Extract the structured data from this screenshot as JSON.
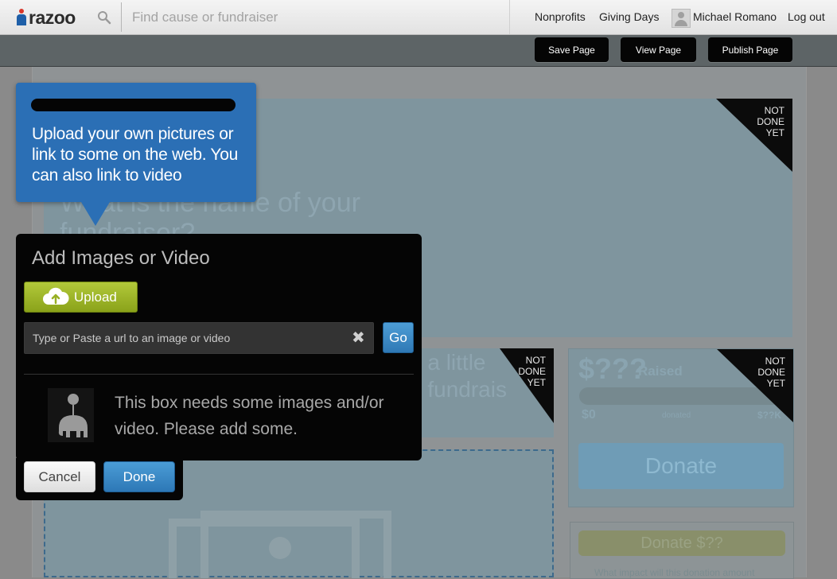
{
  "nav": {
    "logo_text": "razoo",
    "search_placeholder": "Find cause or fundraiser",
    "links": [
      "Nonprofits",
      "Giving Days"
    ],
    "user_name": "Michael Romano",
    "logout": "Log out"
  },
  "toolbar": {
    "save": "Save Page",
    "view": "View Page",
    "publish": "Publish Page"
  },
  "page": {
    "hero_faint_line1": "What is the name of your",
    "hero_faint_line2": "fundraiser?",
    "mid_faint_line1": "g a little",
    "mid_faint_line2": "o fundrais",
    "not_done": "NOT DONE YET",
    "raised_amount": "$???",
    "raised_label": "Raised",
    "progress_left": "$0",
    "progress_mid": "donated",
    "progress_right": "$??K",
    "donate": "Donate",
    "donate_amount": "Donate $??",
    "impact_text": "What impact will this donation amount"
  },
  "tooltip": {
    "text": "Upload your own pictures or link to some on the web. You can also link to video"
  },
  "dialog": {
    "title": "Add Images or Video",
    "upload": "Upload",
    "url_placeholder": "Type or Paste a url to an image or video",
    "go": "Go",
    "empty_message": "This box needs some images and/or video. Please add some.",
    "cancel": "Cancel",
    "done": "Done"
  }
}
